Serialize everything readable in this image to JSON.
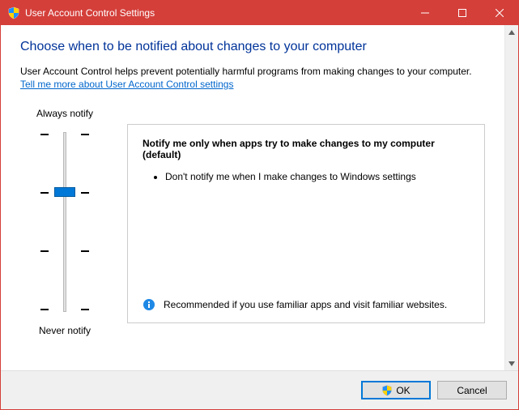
{
  "window": {
    "title": "User Account Control Settings"
  },
  "header": {
    "heading": "Choose when to be notified about changes to your computer",
    "subtext": "User Account Control helps prevent potentially harmful programs from making changes to your computer.",
    "link": "Tell me more about User Account Control settings"
  },
  "slider": {
    "top_label": "Always notify",
    "bottom_label": "Never notify",
    "level": 2,
    "levels_total": 4
  },
  "description": {
    "title": "Notify me only when apps try to make changes to my computer (default)",
    "bullet1": "Don't notify me when I make changes to Windows settings",
    "recommendation": "Recommended if you use familiar apps and visit familiar websites."
  },
  "footer": {
    "ok_label": "OK",
    "cancel_label": "Cancel"
  }
}
